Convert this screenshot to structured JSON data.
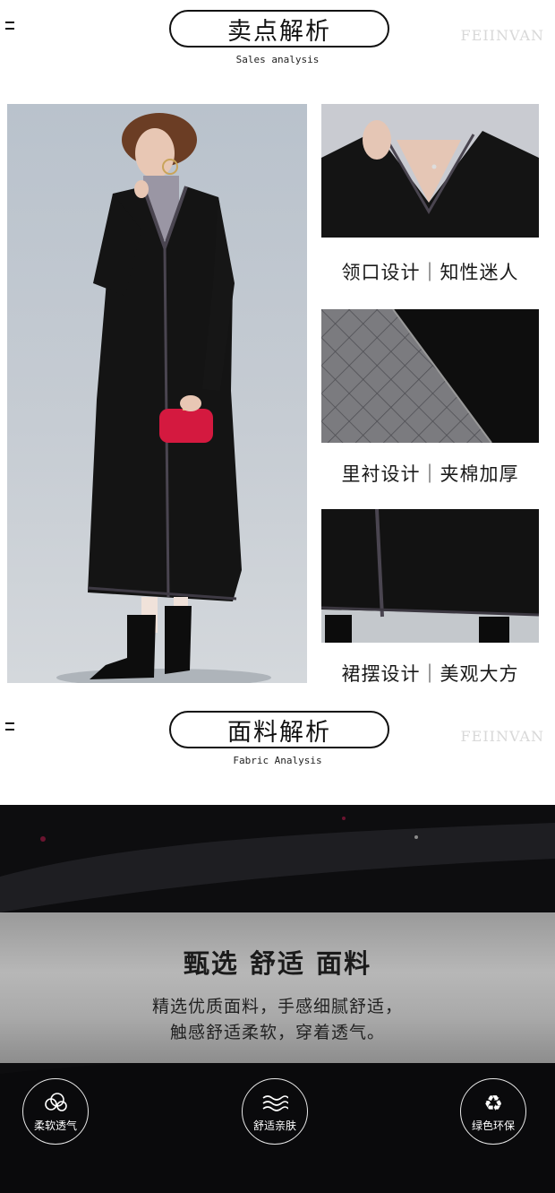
{
  "sales_section": {
    "title": "卖点解析",
    "subtitle": "Sales analysis",
    "watermark": "FEIINVAN"
  },
  "details": [
    {
      "caption": "领口设计｜知性迷人"
    },
    {
      "caption": "里衬设计｜夹棉加厚"
    },
    {
      "caption": "裙摆设计｜美观大方"
    }
  ],
  "fabric_section": {
    "title": "面料解析",
    "subtitle": "Fabric Analysis",
    "watermark": "FEIINVAN",
    "headline": "甄选 舒适 面料",
    "body_line1": "精选优质面料，手感细腻舒适，",
    "body_line2": "触感舒适柔软，穿着透气。"
  },
  "features": [
    {
      "label": "柔软透气",
      "icon": "cloud-icon"
    },
    {
      "label": "舒适亲肤",
      "icon": "waves-icon"
    },
    {
      "label": "绿色环保",
      "icon": "recycle-icon"
    }
  ],
  "colors": {
    "coat": "#141414",
    "clutch": "#d4193f",
    "backdrop": "#c3c9d0",
    "fabric_band": "#b0b0b0"
  }
}
